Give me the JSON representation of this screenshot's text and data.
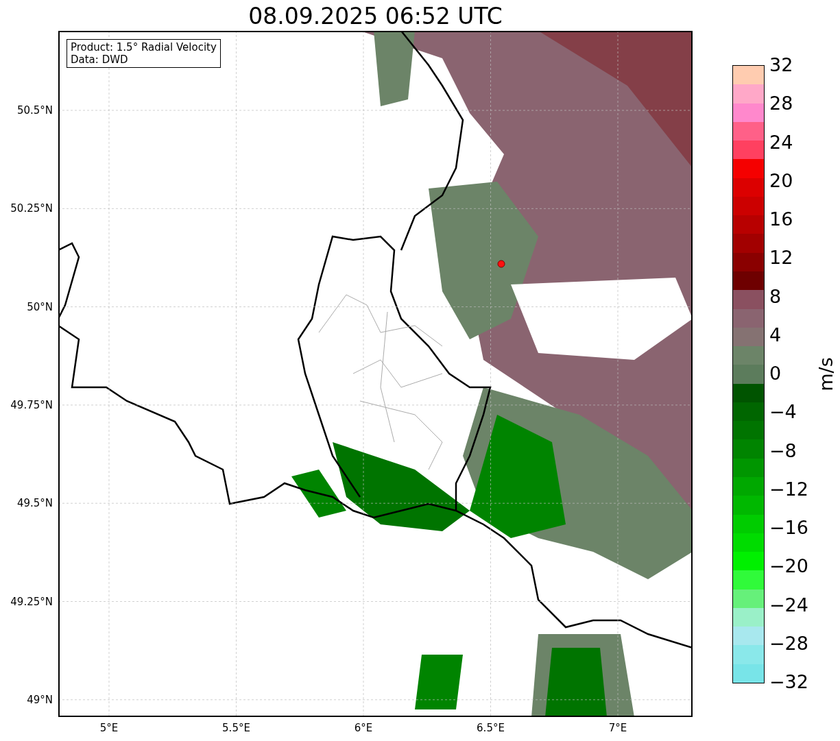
{
  "title": "08.09.2025 06:52 UTC",
  "legend": {
    "lines": [
      "Product: 1.5° Radial Velocity",
      "Data: DWD"
    ]
  },
  "lat_ticks": [
    {
      "label": "50.5°N"
    },
    {
      "label": "50.25°N"
    },
    {
      "label": "50°N"
    },
    {
      "label": "49.75°N"
    },
    {
      "label": "49.5°N"
    },
    {
      "label": "49.25°N"
    },
    {
      "label": "49°N"
    }
  ],
  "lon_ticks": [
    {
      "label": "5°E"
    },
    {
      "label": "5.5°E"
    },
    {
      "label": "6°E"
    },
    {
      "label": "6.5°E"
    },
    {
      "label": "7°E"
    }
  ],
  "colorbar": {
    "unit": "m/s",
    "segments": [
      {
        "color": "#ffccb0"
      },
      {
        "color": "#ffa8c8"
      },
      {
        "color": "#ff88cc"
      },
      {
        "color": "#ff6088"
      },
      {
        "color": "#ff4060"
      },
      {
        "color": "#f50000"
      },
      {
        "color": "#dc0000"
      },
      {
        "color": "#cc0000"
      },
      {
        "color": "#b80000"
      },
      {
        "color": "#a20000"
      },
      {
        "color": "#8a0000"
      },
      {
        "color": "#6e0000"
      },
      {
        "color": "#8a5060"
      },
      {
        "color": "#8a6470"
      },
      {
        "color": "#857272"
      },
      {
        "color": "#6c8468"
      },
      {
        "color": "#5c7c5c"
      },
      {
        "color": "#005400"
      },
      {
        "color": "#006600"
      },
      {
        "color": "#007400"
      },
      {
        "color": "#008400"
      },
      {
        "color": "#009600"
      },
      {
        "color": "#00a800"
      },
      {
        "color": "#00b800"
      },
      {
        "color": "#00cc00"
      },
      {
        "color": "#00dc00"
      },
      {
        "color": "#00f000"
      },
      {
        "color": "#30fa3a"
      },
      {
        "color": "#66f07a"
      },
      {
        "color": "#9af0c8"
      },
      {
        "color": "#a8e8ee"
      },
      {
        "color": "#8ae8ea"
      },
      {
        "color": "#78e4e8"
      }
    ],
    "ticks": [
      "32",
      "28",
      "24",
      "20",
      "16",
      "12",
      "8",
      "4",
      "0",
      "−4",
      "−8",
      "−12",
      "−16",
      "−20",
      "−24",
      "−28",
      "−32"
    ]
  }
}
